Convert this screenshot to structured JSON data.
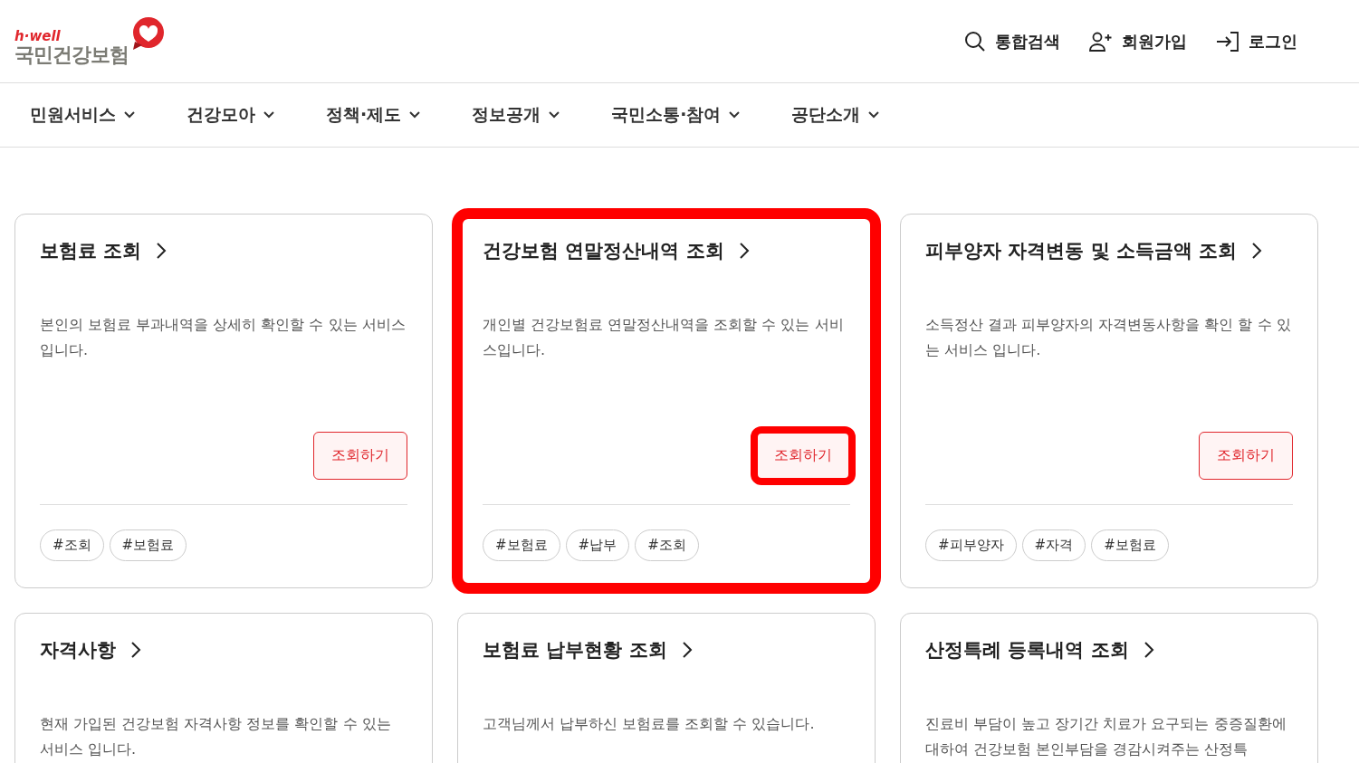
{
  "logo": {
    "tagline": "h·well",
    "name": "국민건강보험"
  },
  "utility_links": [
    {
      "kind": "search",
      "label": "통합검색"
    },
    {
      "kind": "join",
      "label": "회원가입"
    },
    {
      "kind": "login",
      "label": "로그인"
    }
  ],
  "nav": [
    {
      "label": "민원서비스"
    },
    {
      "label": "건강모아"
    },
    {
      "label": "정책·제도"
    },
    {
      "label": "정보공개"
    },
    {
      "label": "국민소통·참여"
    },
    {
      "label": "공단소개"
    }
  ],
  "cards": [
    {
      "title": "보험료 조회",
      "description": "본인의 보험료 부과내역을 상세히 확인할 수 있는 서비스 입니다.",
      "highlighted": false,
      "button": {
        "label": "조회하기",
        "highlighted": false
      },
      "tags": [
        "#조회",
        "#보험료"
      ]
    },
    {
      "title": "건강보험 연말정산내역 조회",
      "description": "개인별 건강보험료 연말정산내역을 조회할 수 있는 서비스입니다.",
      "highlighted": true,
      "button": {
        "label": "조회하기",
        "highlighted": true
      },
      "tags": [
        "#보험료",
        "#납부",
        "#조회"
      ]
    },
    {
      "title": "피부양자 자격변동 및 소득금액 조회",
      "description": "소득정산 결과 피부양자의 자격변동사항을 확인 할 수 있는 서비스 입니다.",
      "highlighted": false,
      "button": {
        "label": "조회하기",
        "highlighted": false
      },
      "tags": [
        "#피부양자",
        "#자격",
        "#보험료"
      ]
    },
    {
      "title": "자격사항",
      "description": "현재 가입된 건강보험 자격사항 정보를 확인할 수 있는 서비스 입니다.",
      "highlighted": false
    },
    {
      "title": "보험료 납부현황 조회",
      "description": "고객님께서 납부하신 보험료를 조회할 수 있습니다.",
      "highlighted": false
    },
    {
      "title": "산정특례 등록내역 조회",
      "description": "진료비 부담이 높고 장기간 치료가 요구되는 중증질환에 대하여 건강보험 본인부담을 경감시켜주는 산정특",
      "highlighted": false
    }
  ]
}
